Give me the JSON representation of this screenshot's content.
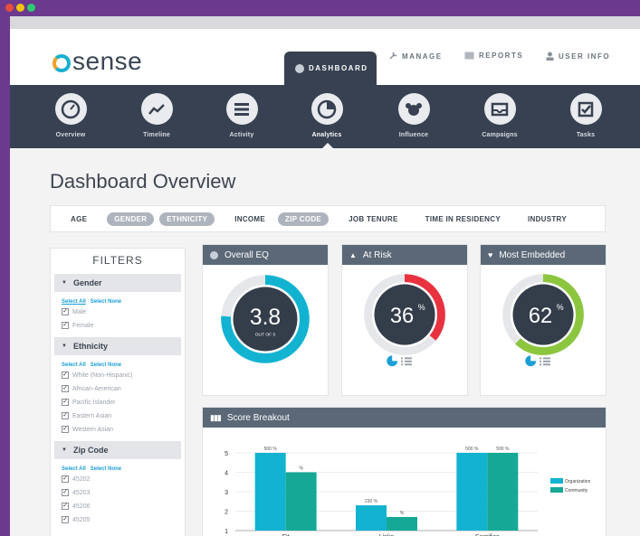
{
  "header": {
    "logo": "sense",
    "nav": [
      {
        "label": "DASHBOARD",
        "icon": "gauge-icon"
      },
      {
        "label": "MANAGE",
        "icon": "wrench-icon"
      },
      {
        "label": "REPORTS",
        "icon": "inbox-icon"
      },
      {
        "label": "USER INFO",
        "icon": "user-icon"
      }
    ]
  },
  "iconbar": {
    "items": [
      {
        "label": "Overview",
        "icon": "speedometer-icon"
      },
      {
        "label": "Timeline",
        "icon": "trend-icon"
      },
      {
        "label": "Activity",
        "icon": "list-icon"
      },
      {
        "label": "Analytics",
        "icon": "pie-icon"
      },
      {
        "label": "Influence",
        "icon": "people-icon"
      },
      {
        "label": "Campaigns",
        "icon": "tray-icon"
      },
      {
        "label": "Tasks",
        "icon": "checkbox-icon"
      }
    ]
  },
  "page": {
    "title": "Dashboard Overview"
  },
  "filter_chips": [
    {
      "label": "AGE",
      "selected": false
    },
    {
      "label": "GENDER",
      "selected": true
    },
    {
      "label": "ETHNICITY",
      "selected": true
    },
    {
      "label": "INCOME",
      "selected": false
    },
    {
      "label": "ZIP CODE",
      "selected": true
    },
    {
      "label": "JOB TENURE",
      "selected": false
    },
    {
      "label": "TIME IN RESIDENCY",
      "selected": false
    },
    {
      "label": "INDUSTRY",
      "selected": false
    }
  ],
  "filters": {
    "title": "FILTERS",
    "select_all": "Select All",
    "select_none": "Select None",
    "sections": [
      {
        "title": "Gender",
        "items": [
          "Male",
          "Female"
        ]
      },
      {
        "title": "Ethnicity",
        "items": [
          "White (Non-Hispanic)",
          "African-American",
          "Pacific Islander",
          "Eastern Asian",
          "Western Asian"
        ]
      },
      {
        "title": "Zip Code",
        "items": [
          "45202",
          "45203",
          "45206",
          "45205"
        ]
      }
    ]
  },
  "cards": {
    "eq": {
      "title": "Overall EQ",
      "value": "3.8",
      "sub": "OUT OF 5",
      "fraction": 0.76,
      "color": "#12b3d1"
    },
    "risk": {
      "title": "At Risk",
      "value": "36",
      "unit": "%",
      "fraction": 0.36,
      "color": "#e8323f"
    },
    "embedded": {
      "title": "Most Embedded",
      "value": "62",
      "unit": "%",
      "fraction": 0.62,
      "color": "#8cc63f"
    }
  },
  "chart_data": {
    "type": "bar",
    "title": "Score Breakout",
    "categories": [
      "Fit",
      "Links",
      "Sacrifice"
    ],
    "series": [
      {
        "name": "Organization",
        "values": [
          5,
          2.3,
          5
        ],
        "color": "#12b3d1"
      },
      {
        "name": "Community",
        "values": [
          4,
          1.7,
          5
        ],
        "color": "#16a897"
      }
    ],
    "data_labels": [
      [
        "500 %",
        "%"
      ],
      [
        "230 %",
        "%"
      ],
      [
        "500 %",
        "500 %"
      ]
    ],
    "yticks": [
      1,
      2,
      3,
      4,
      5
    ],
    "ylim": [
      1,
      5
    ],
    "legend_position": "right"
  }
}
